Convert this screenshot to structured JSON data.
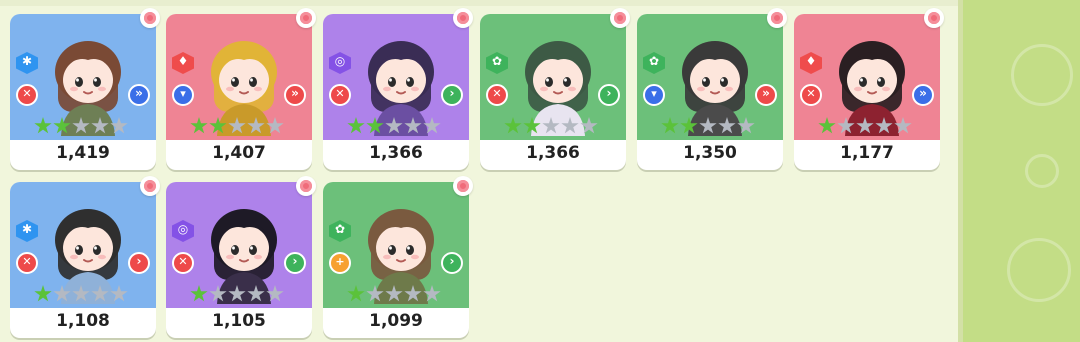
{
  "cards": [
    {
      "value": "1,419",
      "bg": "blue",
      "element": {
        "color": "blue",
        "icon": "snowflake-icon",
        "glyph": "✱"
      },
      "role": {
        "color": "red",
        "icon": "crossed-tools-icon",
        "glyph": "✕"
      },
      "arrow": {
        "color": "blue",
        "icon": "double-chevron-icon",
        "glyph": "»"
      },
      "stars": 2,
      "hair": "#7a4a35",
      "outfit": "#6e7f55"
    },
    {
      "value": "1,407",
      "bg": "pink",
      "element": {
        "color": "red",
        "icon": "flame-icon",
        "glyph": "♦"
      },
      "role": {
        "color": "blue",
        "icon": "shield-icon",
        "glyph": "▾"
      },
      "arrow": {
        "color": "red",
        "icon": "double-chevron-icon",
        "glyph": "»"
      },
      "stars": 2,
      "hair": "#e1b437",
      "outfit": "#c99a2a"
    },
    {
      "value": "1,366",
      "bg": "purple",
      "element": {
        "color": "purple",
        "icon": "swirl-icon",
        "glyph": "◎"
      },
      "role": {
        "color": "red",
        "icon": "crossed-tools-icon",
        "glyph": "✕"
      },
      "arrow": {
        "color": "green",
        "icon": "chevron-icon",
        "glyph": "›"
      },
      "stars": 2,
      "hair": "#3a2d55",
      "outfit": "#6b4fa2"
    },
    {
      "value": "1,366",
      "bg": "green",
      "element": {
        "color": "green",
        "icon": "clover-icon",
        "glyph": "✿"
      },
      "role": {
        "color": "red",
        "icon": "crossed-tools-icon",
        "glyph": "✕"
      },
      "arrow": {
        "color": "green",
        "icon": "chevron-icon",
        "glyph": "›"
      },
      "stars": 2,
      "hair": "#3d5a45",
      "outfit": "#e8e4f0"
    },
    {
      "value": "1,350",
      "bg": "green",
      "element": {
        "color": "green",
        "icon": "clover-icon",
        "glyph": "✿"
      },
      "role": {
        "color": "blue",
        "icon": "shield-icon",
        "glyph": "▾"
      },
      "arrow": {
        "color": "red",
        "icon": "double-chevron-icon",
        "glyph": "»"
      },
      "stars": 2,
      "hair": "#3a3a3a",
      "outfit": "#4b4b4b"
    },
    {
      "value": "1,177",
      "bg": "pink",
      "element": {
        "color": "red",
        "icon": "flame-icon",
        "glyph": "♦"
      },
      "role": {
        "color": "red",
        "icon": "crossed-tools-icon",
        "glyph": "✕"
      },
      "arrow": {
        "color": "blue",
        "icon": "double-chevron-icon",
        "glyph": "»"
      },
      "stars": 1,
      "hair": "#2a1f22",
      "outfit": "#8d2230"
    },
    {
      "value": "1,108",
      "bg": "blue",
      "element": {
        "color": "blue",
        "icon": "snowflake-icon",
        "glyph": "✱"
      },
      "role": {
        "color": "red",
        "icon": "crossed-tools-icon",
        "glyph": "✕"
      },
      "arrow": {
        "color": "red",
        "icon": "chevron-icon",
        "glyph": "›"
      },
      "stars": 1,
      "hair": "#2f2f2f",
      "outfit": "#8fb1d8"
    },
    {
      "value": "1,105",
      "bg": "purple",
      "element": {
        "color": "purple",
        "icon": "swirl-icon",
        "glyph": "◎"
      },
      "role": {
        "color": "red",
        "icon": "crossed-tools-icon",
        "glyph": "✕"
      },
      "arrow": {
        "color": "green",
        "icon": "chevron-icon",
        "glyph": "›"
      },
      "stars": 1,
      "hair": "#1e1a26",
      "outfit": "#3a2f4a"
    },
    {
      "value": "1,099",
      "bg": "green",
      "element": {
        "color": "green",
        "icon": "clover-icon",
        "glyph": "✿"
      },
      "role": {
        "color": "orange",
        "icon": "plus-icon",
        "glyph": "+"
      },
      "arrow": {
        "color": "green",
        "icon": "chevron-icon",
        "glyph": "›"
      },
      "stars": 1,
      "hair": "#7a5a3f",
      "outfit": "#6e7a4a"
    }
  ]
}
